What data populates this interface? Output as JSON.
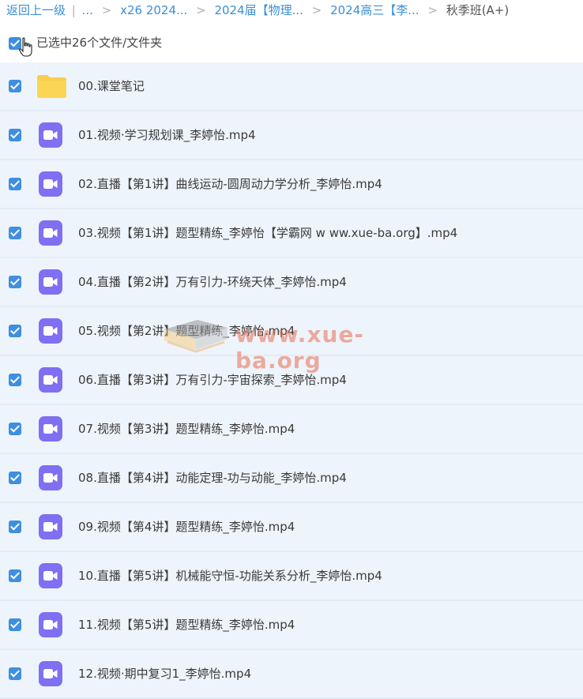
{
  "breadcrumb": {
    "back": "返回上一级",
    "pipe": "|",
    "crumbs": [
      "...",
      "x26 2024...",
      "2024届【物理...",
      "2024高三【李..."
    ],
    "sep": ">",
    "current": "秋季班(A+)"
  },
  "selection": {
    "text": "已选中26个文件/文件夹",
    "checked": true
  },
  "colors": {
    "accent": "#3e8fe0",
    "video_icon": "#7f6ff2",
    "folder": "#f9cf4b",
    "row_bg": "#eef4fb"
  },
  "files": [
    {
      "name": "00.课堂笔记",
      "type": "folder"
    },
    {
      "name": "01.视频·学习规划课_李婷怡.mp4",
      "type": "video"
    },
    {
      "name": "02.直播【第1讲】曲线运动-圆周动力学分析_李婷怡.mp4",
      "type": "video"
    },
    {
      "name": "03.视频【第1讲】题型精练_李婷怡【学霸网 w ww.xue-ba.org】.mp4",
      "type": "video"
    },
    {
      "name": "04.直播【第2讲】万有引力-环绕天体_李婷怡.mp4",
      "type": "video"
    },
    {
      "name": "05.视频【第2讲】题型精练_李婷怡.mp4",
      "type": "video"
    },
    {
      "name": "06.直播【第3讲】万有引力-宇宙探索_李婷怡.mp4",
      "type": "video"
    },
    {
      "name": "07.视频【第3讲】题型精练_李婷怡.mp4",
      "type": "video"
    },
    {
      "name": "08.直播【第4讲】动能定理-功与动能_李婷怡.mp4",
      "type": "video"
    },
    {
      "name": "09.视频【第4讲】题型精练_李婷怡.mp4",
      "type": "video"
    },
    {
      "name": "10.直播【第5讲】机械能守恒-功能关系分析_李婷怡.mp4",
      "type": "video"
    },
    {
      "name": "11.视频【第5讲】题型精练_李婷怡.mp4",
      "type": "video"
    },
    {
      "name": "12.视频·期中复习1_李婷怡.mp4",
      "type": "video"
    }
  ],
  "watermark": {
    "text": "www.xue-ba.org"
  }
}
